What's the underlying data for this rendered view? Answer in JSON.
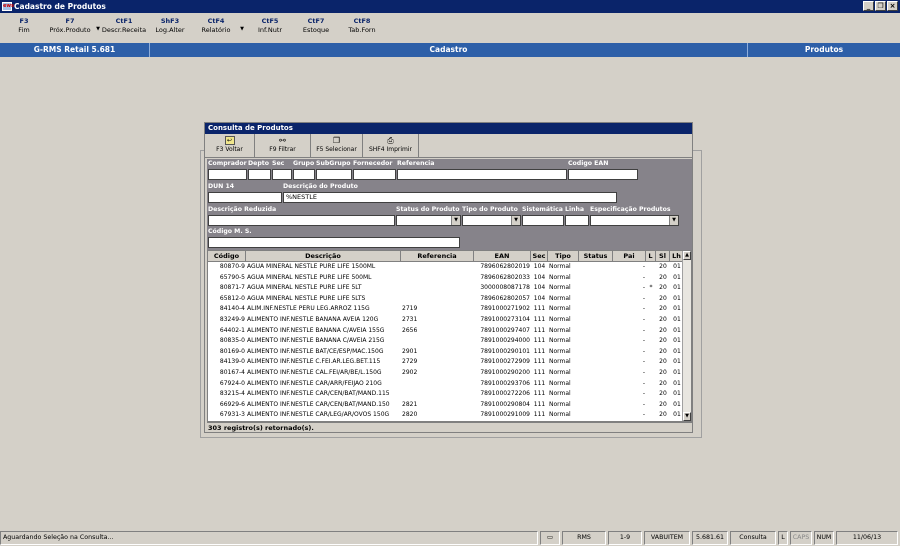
{
  "window": {
    "title": "Cadastro de Produtos",
    "icon": "app-icon",
    "icon_text": "ews"
  },
  "toolbar": [
    {
      "key": "F3",
      "label": "Fim"
    },
    {
      "key": "F7",
      "label": "Próx.Produto"
    },
    {
      "key": "CtF1",
      "label": "Descr.Receita"
    },
    {
      "key": "ShF3",
      "label": "Log.Alter"
    },
    {
      "key": "CtF4",
      "label": "Relatório"
    },
    {
      "key": "CtF5",
      "label": "Inf.Nutr"
    },
    {
      "key": "CtF7",
      "label": "Estoque"
    },
    {
      "key": "CtF8",
      "label": "Tab.Forn"
    }
  ],
  "header": {
    "app": "G-RMS Retail 5.681",
    "section": "Cadastro",
    "module": "Produtos"
  },
  "dialog": {
    "title": "Consulta de Produtos",
    "buttons": [
      {
        "label": "F3 Voltar",
        "icon": "back-icon"
      },
      {
        "label": "F9 Filtrar",
        "icon": "binoculars-icon"
      },
      {
        "label": "F5 Selecionar",
        "icon": "select-icon"
      },
      {
        "label": "SHF4 Imprimir",
        "icon": "printer-icon"
      }
    ],
    "filters": {
      "comprador": "Comprador",
      "depto": "Depto",
      "sec": "Sec",
      "grupo": "Grupo",
      "subgrupo": "SubGrupo",
      "fornecedor": "Fornecedor",
      "referencia": "Referencia",
      "codigo_ean": "Codigo EAN",
      "dun14": "DUN 14",
      "descricao_produto": "Descrição do Produto",
      "descricao_produto_value": "%NESTLE",
      "descricao_reduzida": "Descrição Reduzida",
      "status_produto": "Status do Produto",
      "tipo_produto": "Tipo do Produto",
      "sistematica": "Sistemática",
      "linha": "Linha",
      "especificacao": "Especificação Produtos",
      "codigo_ms": "Código M. S."
    },
    "columns": [
      "Código",
      "Descrição",
      "Referencia",
      "EAN",
      "Sec",
      "Tipo",
      "Status",
      "Pai",
      "L",
      "Sl",
      "Lh"
    ],
    "rows": [
      [
        "80870-9",
        "AGUA MINERAL NESTLE PURE LIFE 1500ML",
        "",
        "7896062802019",
        "104",
        "Normal",
        "",
        "-",
        "",
        "20",
        "01"
      ],
      [
        "65790-5",
        "AGUA MINERAL NESTLE PURE LIFE 500ML",
        "",
        "7896062802033",
        "104",
        "Normal",
        "",
        "-",
        "",
        "20",
        "01"
      ],
      [
        "80871-7",
        "AGUA MINERAL NESTLE PURE LIFE 5LT",
        "",
        "3000008087178",
        "104",
        "Normal",
        "",
        "-",
        "*",
        "20",
        "01"
      ],
      [
        "65812-0",
        "AGUA MINERAL NESTLE PURE LIFE 5LTS",
        "",
        "7896062802057",
        "104",
        "Normal",
        "",
        "-",
        "",
        "20",
        "01"
      ],
      [
        "84140-4",
        "ALIM.INF.NESTLE PERU LEG.ARROZ 115G",
        "2719",
        "7891000271902",
        "111",
        "Normal",
        "",
        "-",
        "",
        "20",
        "01"
      ],
      [
        "83249-9",
        "ALIMENTO INF.NESTLE BANANA AVEIA 120G",
        "2731",
        "7891000273104",
        "111",
        "Normal",
        "",
        "-",
        "",
        "20",
        "01"
      ],
      [
        "64402-1",
        "ALIMENTO INF.NESTLE BANANA C/AVEIA 155G",
        "2656",
        "7891000297407",
        "111",
        "Normal",
        "",
        "-",
        "",
        "20",
        "01"
      ],
      [
        "80835-0",
        "ALIMENTO INF.NESTLE BANANA C/AVEIA 215G",
        "",
        "7891000294000",
        "111",
        "Normal",
        "",
        "-",
        "",
        "20",
        "01"
      ],
      [
        "80169-0",
        "ALIMENTO INF.NESTLE BAT/CE/ESP/MAC.150G",
        "2901",
        "7891000290101",
        "111",
        "Normal",
        "",
        "-",
        "",
        "20",
        "01"
      ],
      [
        "84139-0",
        "ALIMENTO INF.NESTLE C.FEI.AR.LEG.BET.115",
        "2729",
        "7891000272909",
        "111",
        "Normal",
        "",
        "-",
        "",
        "20",
        "01"
      ],
      [
        "80167-4",
        "ALIMENTO INF.NESTLE CAL.FEI/AR/BE/L.150G",
        "2902",
        "7891000290200",
        "111",
        "Normal",
        "",
        "-",
        "",
        "20",
        "01"
      ],
      [
        "67924-0",
        "ALIMENTO INF.NESTLE CAR/ARR/FEIJAO 210G",
        "",
        "7891000293706",
        "111",
        "Normal",
        "",
        "-",
        "",
        "20",
        "01"
      ],
      [
        "83215-4",
        "ALIMENTO INF.NESTLE CAR/CEN/BAT/MAND.115",
        "",
        "7891000272206",
        "111",
        "Normal",
        "",
        "-",
        "",
        "20",
        "01"
      ],
      [
        "66929-6",
        "ALIMENTO INF.NESTLE CAR/CEN/BAT/MAND.150",
        "2821",
        "7891000290804",
        "111",
        "Normal",
        "",
        "-",
        "",
        "20",
        "01"
      ],
      [
        "67931-3",
        "ALIMENTO INF.NESTLE CAR/LEG/AR/OVOS 150G",
        "2820",
        "7891000291009",
        "111",
        "Normal",
        "",
        "-",
        "",
        "20",
        "01"
      ]
    ],
    "records_text": "303 registro(s) retornado(s)."
  },
  "statusbar": {
    "message": "Aguardando Seleção na Consulta...",
    "system": "RMS",
    "page": "1-9",
    "user": "VABUITEM",
    "version": "5.681.61",
    "mode": "Consulta",
    "l": "L",
    "caps": "CAPS",
    "num": "NUM",
    "date": "11/06/13",
    "icon": "document-icon"
  }
}
